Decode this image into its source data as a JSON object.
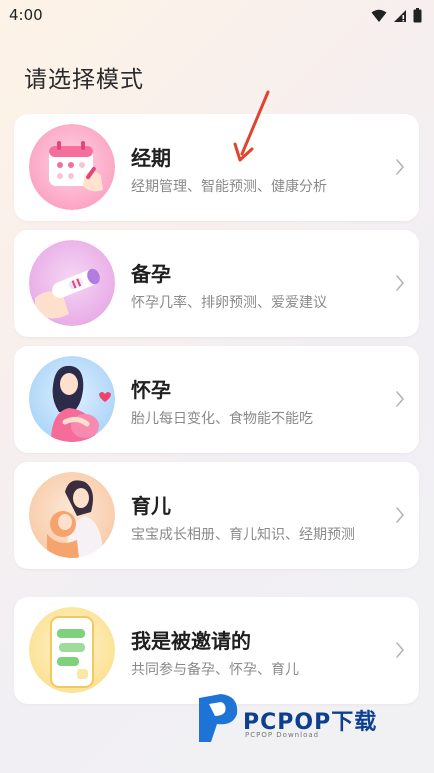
{
  "status": {
    "time": "4:00"
  },
  "page": {
    "title": "请选择模式"
  },
  "modes": [
    {
      "title": "经期",
      "desc": "经期管理、智能预测、健康分析",
      "icon": "calendar-hand-icon"
    },
    {
      "title": "备孕",
      "desc": "怀孕几率、排卵预测、爱爱建议",
      "icon": "test-strip-icon"
    },
    {
      "title": "怀孕",
      "desc": "胎儿每日变化、食物能不能吃",
      "icon": "pregnant-woman-icon"
    },
    {
      "title": "育儿",
      "desc": "宝宝成长相册、育儿知识、经期预测",
      "icon": "mother-baby-icon"
    },
    {
      "title": "我是被邀请的",
      "desc": "共同参与备孕、怀孕、育儿",
      "icon": "phone-chat-icon"
    }
  ],
  "watermark": {
    "text": "PCPOP下载",
    "sub": "PCPOP Download"
  },
  "colors": {
    "accent_arrow": "#e0432f",
    "brand_blue": "#0d3f8f"
  }
}
